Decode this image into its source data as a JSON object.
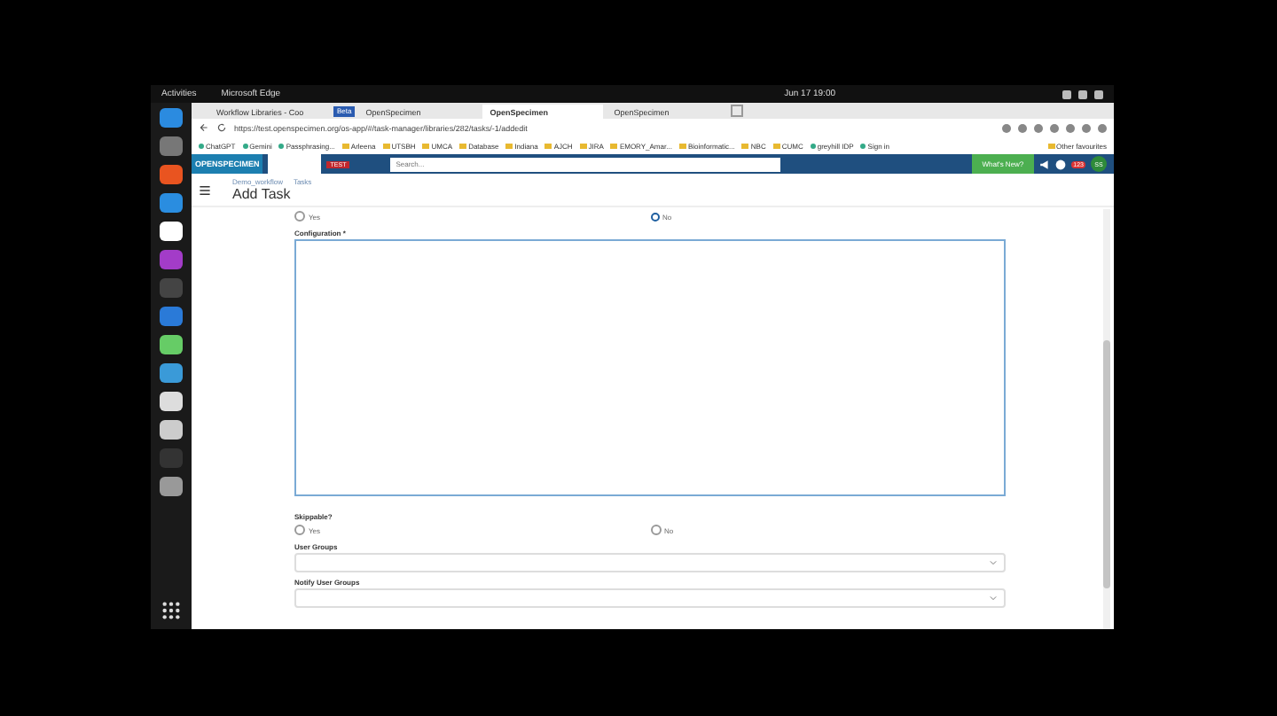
{
  "top_bar": {
    "activities": "Activities",
    "app": "Microsoft Edge",
    "clock": "Jun 17  19:00"
  },
  "browser": {
    "tab_group_label": "Beta",
    "tabs": [
      {
        "title": "Workflow Libraries - Coo",
        "selected": false
      },
      {
        "title": "OpenSpecimen",
        "selected": false
      },
      {
        "title": "OpenSpecimen",
        "selected": true
      },
      {
        "title": "OpenSpecimen",
        "selected": false
      }
    ],
    "url": "https://test.openspecimen.org/os-app/#/task-manager/libraries/282/tasks/-1/addedit",
    "bookmarks": [
      {
        "label": "ChatGPT",
        "kind": "site"
      },
      {
        "label": "Gemini",
        "kind": "site"
      },
      {
        "label": "Passphrasing...",
        "kind": "site"
      },
      {
        "label": "Arleena",
        "kind": "folder"
      },
      {
        "label": "UTSBH",
        "kind": "folder"
      },
      {
        "label": "UMCA",
        "kind": "folder"
      },
      {
        "label": "Database",
        "kind": "folder"
      },
      {
        "label": "Indiana",
        "kind": "folder"
      },
      {
        "label": "AJCH",
        "kind": "folder"
      },
      {
        "label": "JIRA",
        "kind": "folder"
      },
      {
        "label": "EMORY_Amar...",
        "kind": "folder"
      },
      {
        "label": "Bioinformatic...",
        "kind": "folder"
      },
      {
        "label": "NBC",
        "kind": "folder"
      },
      {
        "label": "CUMC",
        "kind": "folder"
      },
      {
        "label": "greyhill IDP",
        "kind": "site"
      },
      {
        "label": "Sign in",
        "kind": "site"
      }
    ],
    "other_favourites": "Other favourites"
  },
  "app_header": {
    "logo": "OPENSPECIMEN",
    "env_badge": "TEST",
    "search_placeholder": "Search...",
    "whats_new": "What's New?",
    "notifications": "123",
    "avatar": "SS"
  },
  "page": {
    "breadcrumbs": [
      "Demo_workflow",
      "Tasks"
    ],
    "title": "Add Task",
    "top_options": [
      {
        "label": "Yes",
        "selected": false
      },
      {
        "label": "No",
        "selected": true
      }
    ],
    "configuration": {
      "label": "Configuration *"
    },
    "skippable": {
      "label": "Skippable?",
      "options": [
        {
          "label": "Yes",
          "selected": false
        },
        {
          "label": "No",
          "selected": false
        }
      ]
    },
    "user_groups": {
      "label": "User Groups"
    },
    "notify_user_groups": {
      "label": "Notify User Groups"
    }
  }
}
